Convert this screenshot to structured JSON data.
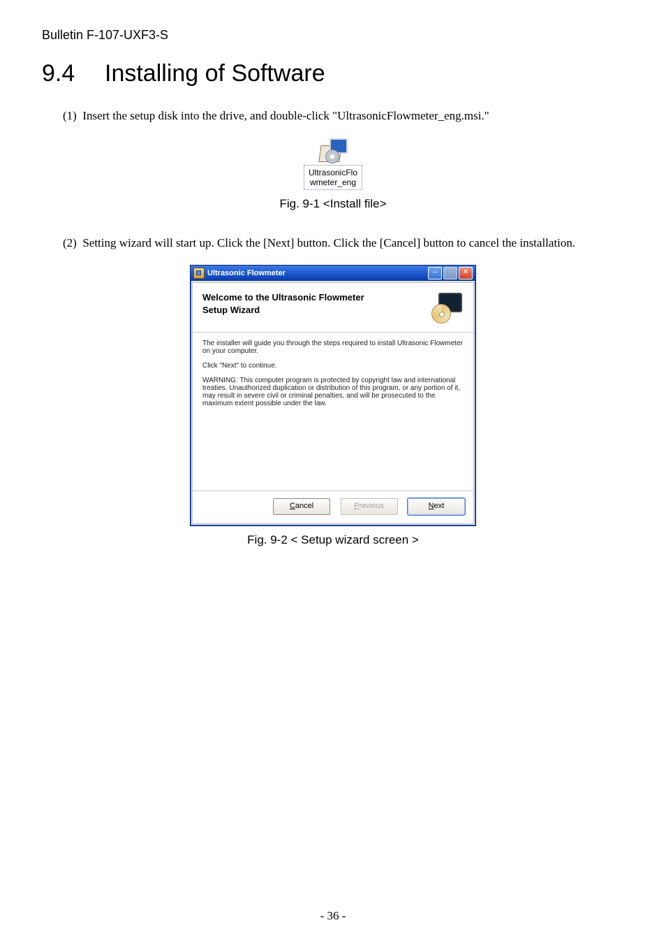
{
  "header": {
    "bulletin": "Bulletin F-107-UXF3-S"
  },
  "section": {
    "number": "9.4",
    "title": "Installing of Software"
  },
  "steps": {
    "s1_marker": "(1)",
    "s1_text": "Insert the setup disk into the drive, and double-click \"UltrasonicFlowmeter_eng.msi.\"",
    "s2_marker": "(2)",
    "s2_text": "Setting wizard will start up.    Click the [Next] button.    Click the [Cancel] button to cancel the installation."
  },
  "fig1": {
    "filename_line1": "UltrasonicFlo",
    "filename_line2": "wmeter_eng",
    "caption": "Fig. 9-1 <Install file>"
  },
  "fig2": {
    "caption": "Fig. 9-2 < Setup wizard screen >"
  },
  "wizard": {
    "title": "Ultrasonic Flowmeter",
    "welcome_line1": "Welcome to the Ultrasonic Flowmeter",
    "welcome_line2": "Setup Wizard",
    "body1": "The installer will guide you through the steps required to install Ultrasonic Flowmeter on your computer.",
    "body2": "Click \"Next\" to continue.",
    "warning": "WARNING: This computer program is protected by copyright law and international treaties. Unauthorized duplication or distribution of this program, or any portion of it, may result in severe civil or criminal penalties, and will be prosecuted to the maximum extent possible under the law.",
    "buttons": {
      "cancel": "Cancel",
      "previous": "Previous",
      "next": "Next",
      "cancel_accel": "C",
      "previous_accel": "P",
      "next_accel": "N",
      "cancel_rest": "ancel",
      "previous_rest": "revious",
      "next_rest": "ext"
    }
  },
  "page_number": "- 36 -"
}
